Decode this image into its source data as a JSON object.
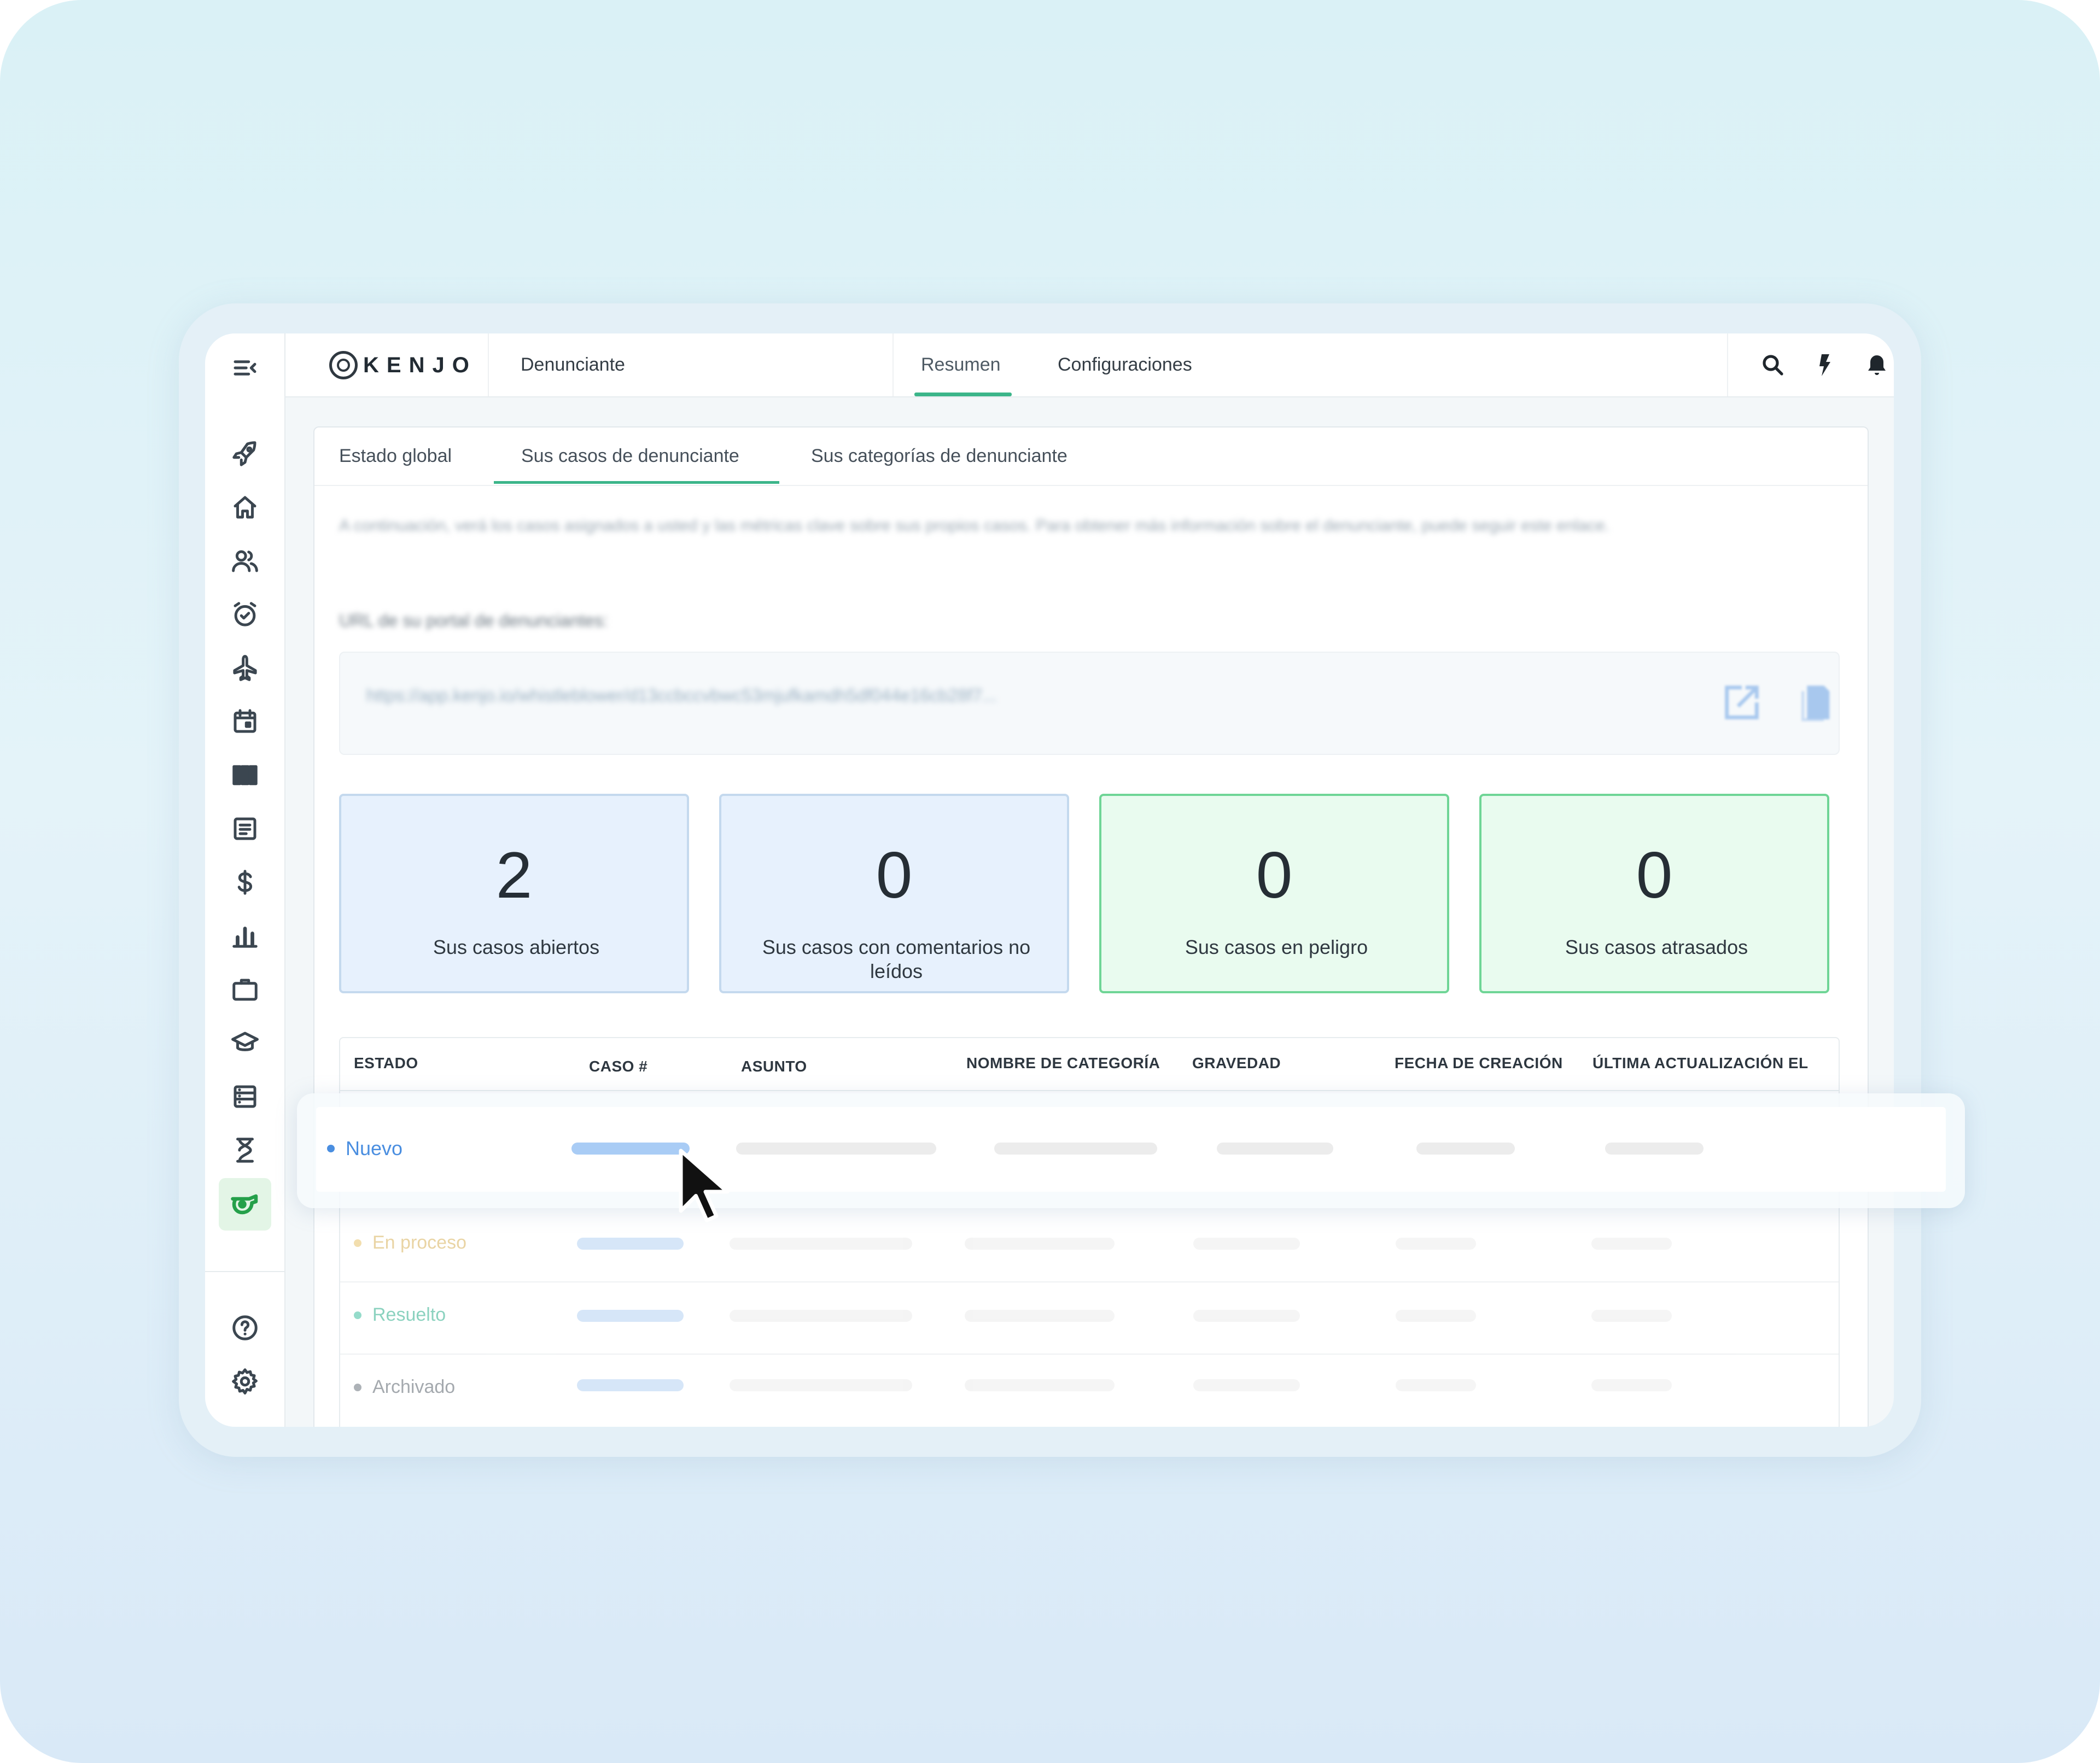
{
  "app": {
    "logo_text": "KENJO",
    "header_tabs": [
      "Denunciante",
      "Resumen",
      "Configuraciones"
    ],
    "active_header_tab": "Resumen"
  },
  "sidebar": {
    "items": [
      "menu-collapse-icon",
      "rocket-icon",
      "home-icon",
      "people-icon",
      "alarm-clock-icon",
      "airplane-icon",
      "calendar-icon",
      "columns-icon",
      "document-icon",
      "dollar-icon",
      "bar-chart-icon",
      "briefcase-icon",
      "graduation-cap-icon",
      "list-icon",
      "hourglass-icon",
      "whistle-icon",
      "help-icon",
      "settings-icon"
    ],
    "active_item": "whistle-icon",
    "active_color": "#25a04a"
  },
  "subtabs": {
    "items": [
      "Estado global",
      "Sus casos de denunciante",
      "Sus categorías de denunciante"
    ],
    "active": "Sus casos de denunciante"
  },
  "intro": {
    "text": "A continuación, verá los casos asignados a usted y las métricas clave sobre sus propios casos. Para obtener más información sobre el denunciante, puede seguir este enlace.",
    "url_label": "URL de su portal de denunciantes:",
    "url_value": "https://app.kenjo.io/whistleblower/d13ccbccvbwc53mjufkamdh5df044e16cb28f7..."
  },
  "stats": [
    {
      "value": "2",
      "label": "Sus casos abiertos",
      "tone": "blue"
    },
    {
      "value": "0",
      "label": "Sus casos con comentarios no leídos",
      "tone": "blue"
    },
    {
      "value": "0",
      "label": "Sus casos en peligro",
      "tone": "green"
    },
    {
      "value": "0",
      "label": "Sus casos atrasados",
      "tone": "green"
    }
  ],
  "table": {
    "columns": [
      "ESTADO",
      "CASO #",
      "ASUNTO",
      "NOMBRE DE CATEGORÍA",
      "GRAVEDAD",
      "FECHA DE CREACIÓN",
      "ÚLTIMA ACTUALIZACIÓN EL"
    ],
    "rows": [
      {
        "status": "Nuevo",
        "color": "#4a8ee0"
      },
      {
        "status": "En proceso",
        "color": "#e8c46c"
      },
      {
        "status": "Resuelto",
        "color": "#3fbfa0"
      },
      {
        "status": "Archivado",
        "color": "#6b757e"
      }
    ]
  },
  "colors": {
    "accent_green": "#3cb58a",
    "blue_card": "#e7f1fd",
    "green_card": "#e9fbef"
  }
}
